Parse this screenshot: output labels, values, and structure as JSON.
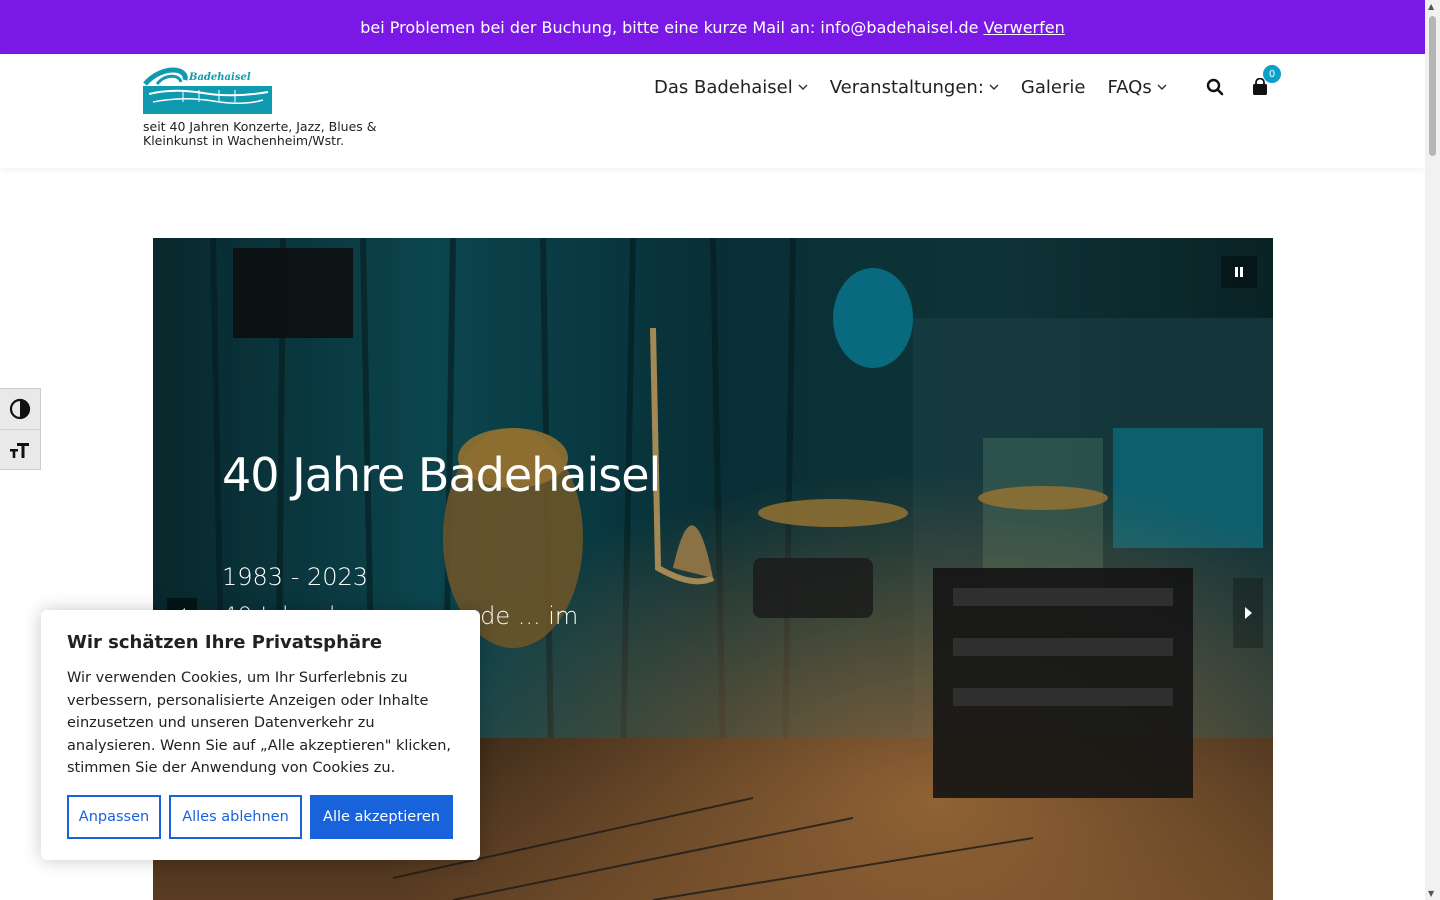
{
  "notice": {
    "text": "bei Problemen bei der Buchung, bitte eine kurze Mail an: info@badehaisel.de",
    "dismiss_label": "Verwerfen"
  },
  "header": {
    "logo_alt": "Badehaisel",
    "tagline": "seit 40 Jahren Konzerte, Jazz, Blues & Kleinkunst in Wachenheim/Wstr.",
    "nav": [
      {
        "label": "Das Badehaisel",
        "has_dropdown": true
      },
      {
        "label": "Veranstaltungen:",
        "has_dropdown": true
      },
      {
        "label": "Galerie",
        "has_dropdown": false
      },
      {
        "label": "FAQs",
        "has_dropdown": true
      }
    ],
    "search_icon": "search-icon",
    "cart_icon": "shopping-bag-icon",
    "cart_count": "0"
  },
  "hero": {
    "title": "40 Jahre Badehaisel",
    "years": "1983 - 2023",
    "subtitle": "40 Jahre herausragende ... im Wachenheimer"
  },
  "a11y": {
    "contrast_icon": "contrast-icon",
    "fontsize_icon": "font-size-icon"
  },
  "cookie": {
    "title": "Wir schätzen Ihre Privatsphäre",
    "text": "Wir verwenden Cookies, um Ihr Surferlebnis zu verbessern, personalisierte Anzeigen oder Inhalte einzusetzen und unseren Datenverkehr zu analysieren. Wenn Sie auf „Alle akzeptieren\" klicken, stimmen Sie der Anwendung von Cookies zu.",
    "customize_label": "Anpassen",
    "reject_label": "Alles ablehnen",
    "accept_label": "Alle akzeptieren"
  },
  "colors": {
    "notice_bg": "#7a18e6",
    "accent_blue": "#1863dc",
    "badge": "#0aa0c8"
  }
}
